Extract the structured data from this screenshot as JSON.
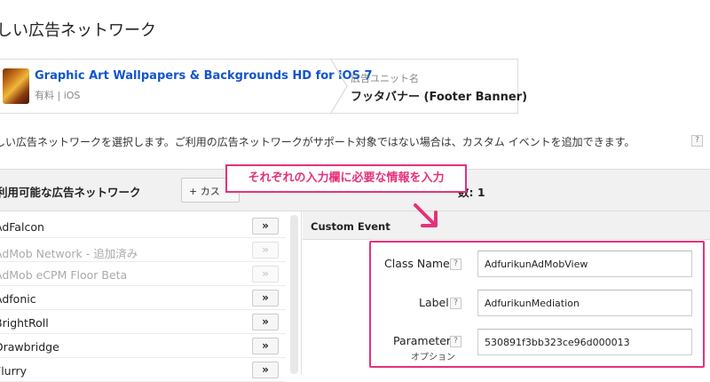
{
  "page": {
    "title": "しい広告ネットワーク"
  },
  "app_card": {
    "app_name": "Graphic Art Wallpapers & Backgrounds HD for iOS 7",
    "app_meta": "有料 | iOS",
    "ad_unit_label": "広告ユニット名",
    "ad_unit_name": "フッタバナー (Footer Banner)"
  },
  "description": "しい広告ネットワークを選択します。ご利用の広告ネットワークがサポート対象ではない場合は、カスタム イベントを追加できます。",
  "help_glyph": "?",
  "networks_panel": {
    "heading": "利用可能な広告ネットワーク",
    "custom_button": "+ カス",
    "selected_count": "数: 1",
    "add_glyph": "»",
    "items": [
      {
        "name": "AdFalcon",
        "disabled": false
      },
      {
        "name": "AdMob Network - 追加済み",
        "disabled": true
      },
      {
        "name": "AdMob eCPM Floor Beta",
        "disabled": true
      },
      {
        "name": "Adfonic",
        "disabled": false
      },
      {
        "name": "BrightRoll",
        "disabled": false
      },
      {
        "name": "Drawbridge",
        "disabled": false
      },
      {
        "name": "Flurry",
        "disabled": false
      }
    ]
  },
  "annotation": {
    "text": "それぞれの入力欄に必要な情報を入力",
    "color": "#e6317a"
  },
  "custom_event": {
    "title": "Custom Event",
    "class_name_label": "Class Name",
    "class_name_value": "AdfurikunAdMobView",
    "label_label": "Label",
    "label_value": "AdfurikunMediation",
    "parameter_label": "Parameter",
    "parameter_optional": "オプション",
    "parameter_value": "530891f3bb323ce96d000013"
  },
  "colors": {
    "link": "#1155cc",
    "accent": "#e6317a"
  }
}
